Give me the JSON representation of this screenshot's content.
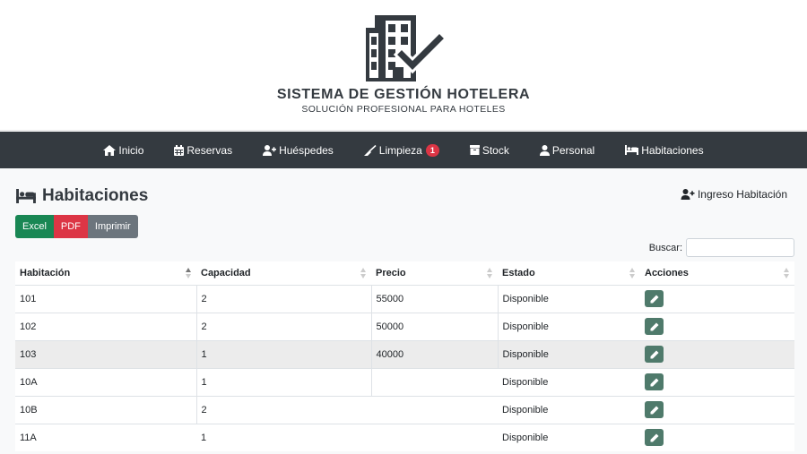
{
  "brand": {
    "title": "SISTEMA DE GESTIÓN HOTELERA",
    "subtitle": "SOLUCIÓN PROFESIONAL PARA HOTELES",
    "logo_icon": "hotel-building-check-icon"
  },
  "nav": {
    "items": [
      {
        "label": "Inicio",
        "icon": "home-icon"
      },
      {
        "label": "Reservas",
        "icon": "calendar-icon"
      },
      {
        "label": "Huéspedes",
        "icon": "user-plus-icon"
      },
      {
        "label": "Limpieza",
        "icon": "broom-icon",
        "badge": "1"
      },
      {
        "label": "Stock",
        "icon": "box-icon"
      },
      {
        "label": "Personal",
        "icon": "user-icon"
      },
      {
        "label": "Habitaciones",
        "icon": "bed-icon"
      }
    ]
  },
  "page": {
    "title": "Habitaciones",
    "title_icon": "bed-icon",
    "add_label": "Ingreso Habitación"
  },
  "export": {
    "excel": "Excel",
    "pdf": "PDF",
    "print": "Imprimir"
  },
  "search": {
    "label": "Buscar:",
    "value": ""
  },
  "table": {
    "columns": [
      "Habitación",
      "Capacidad",
      "Precio",
      "Estado",
      "Acciones"
    ],
    "rows": [
      {
        "room": "101",
        "capacity": "2",
        "price": "55000",
        "status": "Disponible"
      },
      {
        "room": "102",
        "capacity": "2",
        "price": "50000",
        "status": "Disponible"
      },
      {
        "room": "103",
        "capacity": "1",
        "price": "40000",
        "status": "Disponible"
      },
      {
        "room": "10A",
        "capacity": "1",
        "price": "",
        "status": "Disponible"
      },
      {
        "room": "10B",
        "capacity": "2",
        "price": "",
        "status": "Disponible"
      },
      {
        "room": "11A",
        "capacity": "1",
        "price": "",
        "status": "Disponible"
      }
    ]
  },
  "colors": {
    "navbar": "#343a40",
    "excel": "#198754",
    "pdf": "#dc3545",
    "print": "#6c757d",
    "edit": "#4f7a6b",
    "badge": "#dc3545"
  }
}
